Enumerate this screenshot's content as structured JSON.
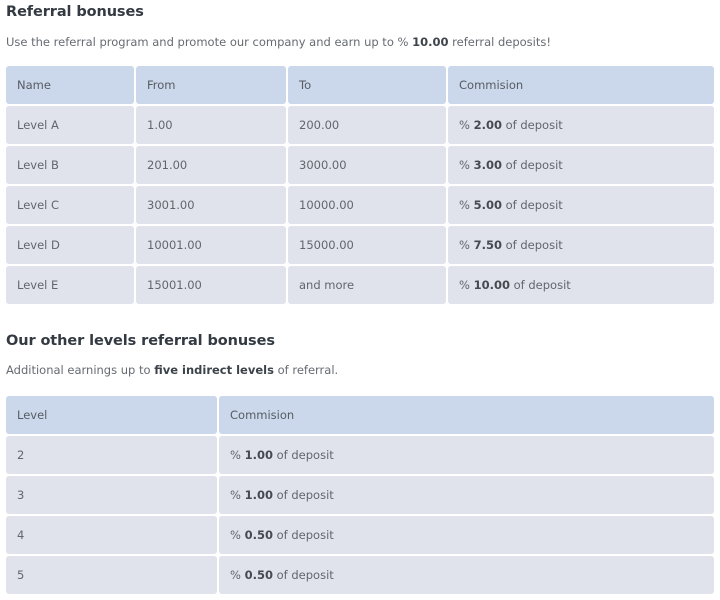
{
  "section1": {
    "title": "Referral bonuses",
    "description_prefix": "Use the referral program and promote our company and earn up to % ",
    "description_bold": "10.00",
    "description_suffix": " referral deposits!",
    "table": {
      "headers": [
        "Name",
        "From",
        "To",
        "Commision"
      ],
      "rows": [
        {
          "name": "Level A",
          "from": "1.00",
          "to": "200.00",
          "commission_prefix": "% ",
          "commission_value": "2.00",
          "commission_suffix": " of deposit"
        },
        {
          "name": "Level B",
          "from": "201.00",
          "to": "3000.00",
          "commission_prefix": "% ",
          "commission_value": "3.00",
          "commission_suffix": " of deposit"
        },
        {
          "name": "Level C",
          "from": "3001.00",
          "to": "10000.00",
          "commission_prefix": "% ",
          "commission_value": "5.00",
          "commission_suffix": " of deposit"
        },
        {
          "name": "Level D",
          "from": "10001.00",
          "to": "15000.00",
          "commission_prefix": "% ",
          "commission_value": "7.50",
          "commission_suffix": " of deposit"
        },
        {
          "name": "Level E",
          "from": "15001.00",
          "to": "and more",
          "commission_prefix": "% ",
          "commission_value": "10.00",
          "commission_suffix": " of deposit"
        }
      ]
    }
  },
  "section2": {
    "title": "Our other levels referral bonuses",
    "description_prefix": "Additional earnings up to ",
    "description_bold": "five indirect levels",
    "description_suffix": " of referral.",
    "table": {
      "headers": [
        "Level",
        "Commision"
      ],
      "rows": [
        {
          "level": "2",
          "commission_prefix": "% ",
          "commission_value": "1.00",
          "commission_suffix": " of deposit"
        },
        {
          "level": "3",
          "commission_prefix": "% ",
          "commission_value": "1.00",
          "commission_suffix": " of deposit"
        },
        {
          "level": "4",
          "commission_prefix": "% ",
          "commission_value": "0.50",
          "commission_suffix": " of deposit"
        },
        {
          "level": "5",
          "commission_prefix": "% ",
          "commission_value": "0.50",
          "commission_suffix": " of deposit"
        }
      ]
    }
  }
}
